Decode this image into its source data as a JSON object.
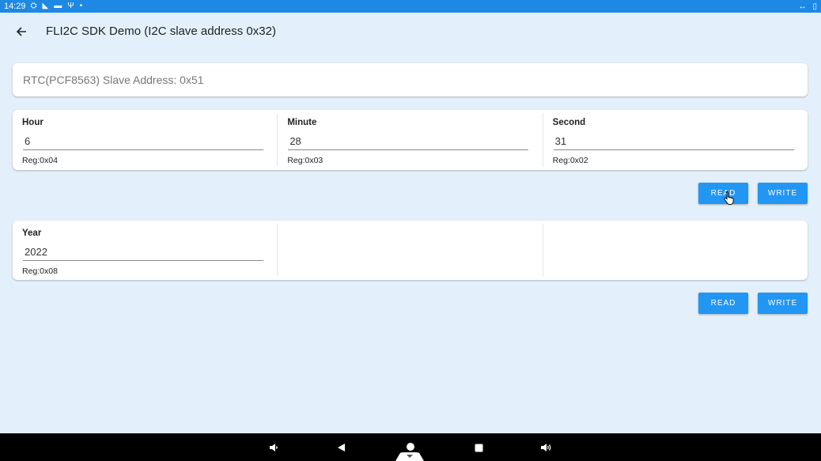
{
  "status_bar": {
    "time": "14:29",
    "icons": [
      "settings-icon",
      "wifi-off-icon",
      "keyboard-icon",
      "usb-icon",
      "dot-icon"
    ],
    "right_icons": [
      "vpn-arrows-icon",
      "battery-icon"
    ]
  },
  "app_bar": {
    "title": "FLI2C SDK Demo (I2C slave address 0x32)"
  },
  "rtc": {
    "address_label": "RTC(PCF8563) Slave Address: 0x51"
  },
  "time_card": {
    "fields": [
      {
        "label": "Hour",
        "value": "6",
        "reg": "Reg:0x04"
      },
      {
        "label": "Minute",
        "value": "28",
        "reg": "Reg:0x03"
      },
      {
        "label": "Second",
        "value": "31",
        "reg": "Reg:0x02"
      }
    ],
    "read_label": "READ",
    "write_label": "WRITE"
  },
  "date_card": {
    "fields": [
      {
        "label": "Year",
        "value": "2022",
        "reg": "Reg:0x08"
      }
    ],
    "read_label": "READ",
    "write_label": "WRITE"
  },
  "nav_bar": {
    "buttons": [
      "volume-down-icon",
      "back-triangle-icon",
      "home-circle-icon",
      "recents-square-icon",
      "volume-up-icon"
    ]
  },
  "colors": {
    "status_bar": "#1e88e5",
    "background": "#e3f0fb",
    "button": "#2196f3"
  }
}
